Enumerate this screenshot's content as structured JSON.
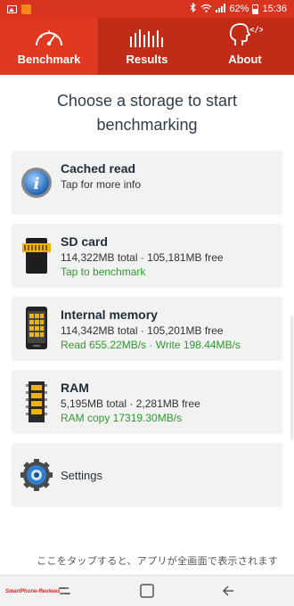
{
  "status_bar": {
    "battery": "62%",
    "time": "15:36",
    "icons": [
      "image-icon",
      "app-notification-icon",
      "bluetooth-icon",
      "wifi-icon",
      "signal-icon",
      "battery-icon"
    ]
  },
  "tabs": [
    {
      "label": "Benchmark",
      "icon": "speedometer-icon",
      "active": true
    },
    {
      "label": "Results",
      "icon": "bar-chart-icon",
      "active": false
    },
    {
      "label": "About",
      "icon": "head-code-icon",
      "active": false
    }
  ],
  "heading": "Choose a storage to start benchmarking",
  "cards": {
    "cached": {
      "title": "Cached read",
      "line1": "Tap for more info",
      "icon": "info-icon"
    },
    "sd": {
      "title": "SD card",
      "line1": "114,322MB total · 105,181MB free",
      "line2": "Tap to benchmark",
      "icon": "sd-card-icon"
    },
    "internal": {
      "title": "Internal memory",
      "line1": "114,342MB total · 105,201MB free",
      "line2": "Read 655.22MB/s · Write 198.44MB/s",
      "icon": "phone-memory-icon"
    },
    "ram": {
      "title": "RAM",
      "line1": "5,195MB total · 2,281MB free",
      "line2": "RAM copy 17319.30MB/s",
      "icon": "ram-chip-icon"
    },
    "settings": {
      "title": "Settings",
      "icon": "settings-gear-icon"
    }
  },
  "footer_text": "ここをタップすると、アプリが全画面で表示されます",
  "watermark": "SmartPhone-Reviews",
  "colors": {
    "accent": "#e0391f",
    "tab_inactive": "#c02c17",
    "card_bg": "#f2f2f2",
    "positive_text": "#2e9a2e"
  }
}
